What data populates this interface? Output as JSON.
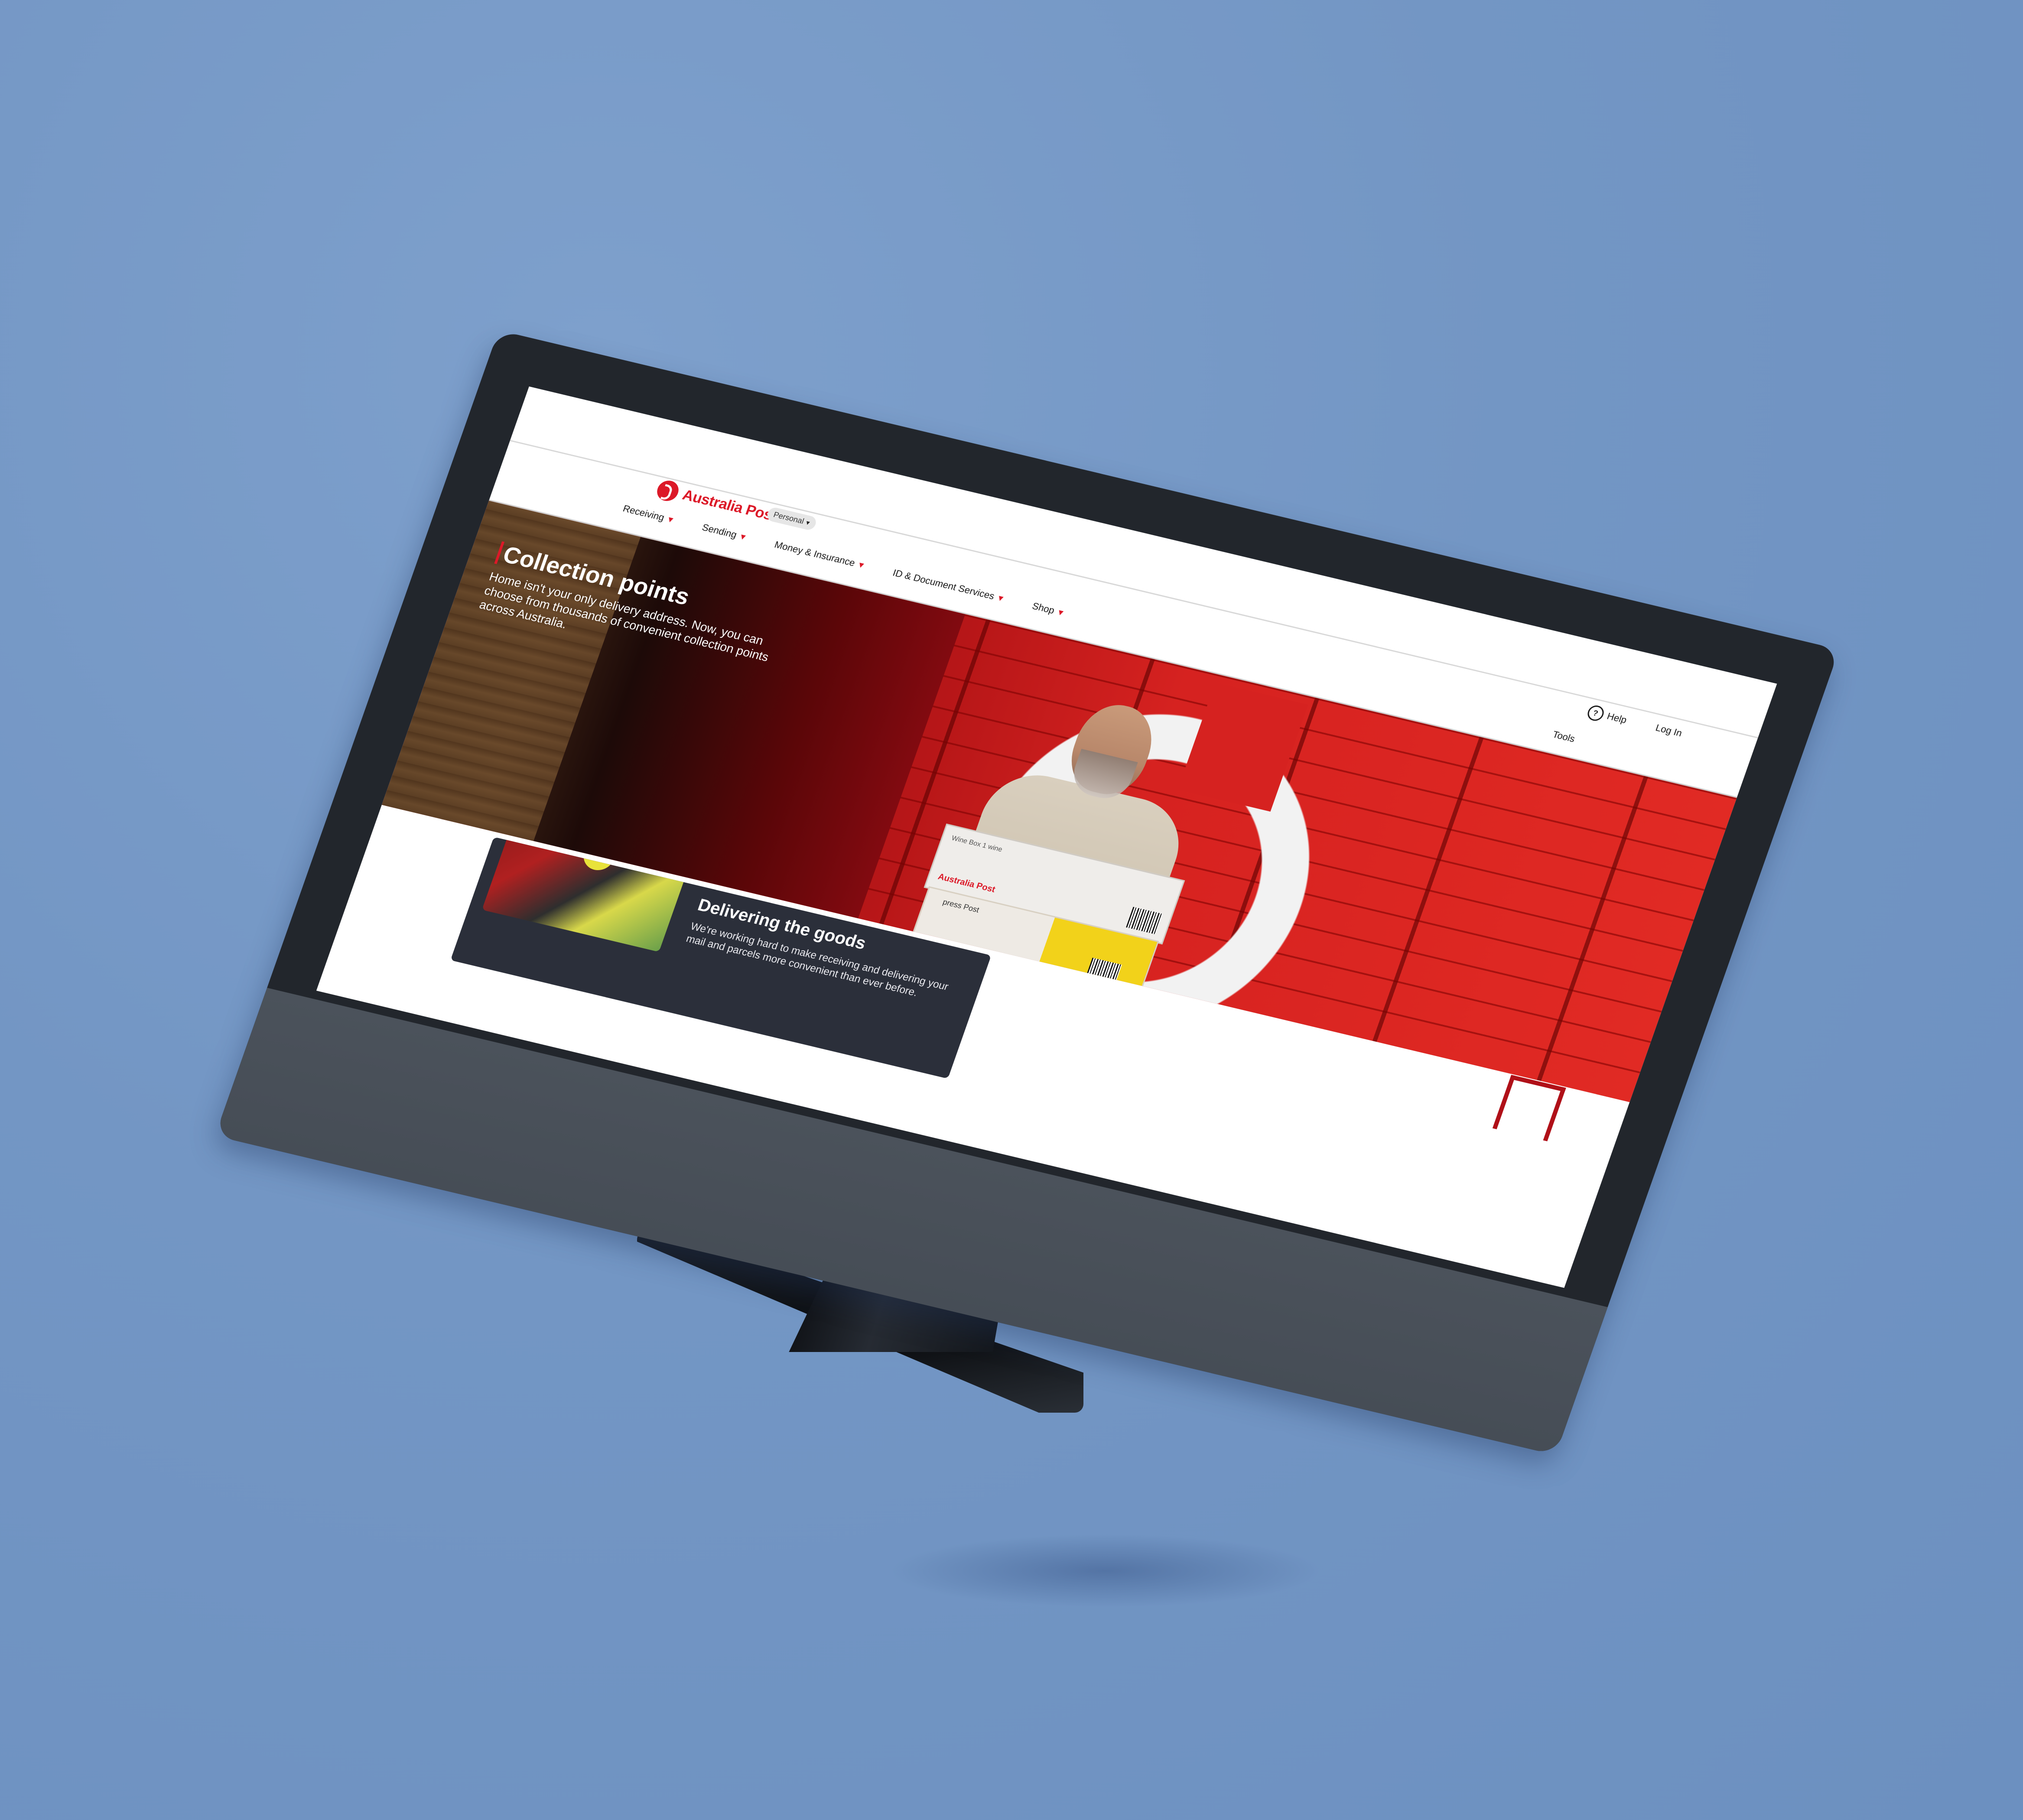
{
  "header": {
    "logo_text": "Australia Post",
    "audience_select": "Personal",
    "nav": [
      {
        "label": "Receiving"
      },
      {
        "label": "Sending"
      },
      {
        "label": "Money & Insurance"
      },
      {
        "label": "ID & Document Services"
      },
      {
        "label": "Shop"
      }
    ],
    "help_label": "Help",
    "login_label": "Log In",
    "tools_label": "Tools"
  },
  "hero": {
    "title": "Collection points",
    "subtitle": "Home isn't your only delivery address. Now, you can choose from thousands of convenient collection points across Australia.",
    "box_brand": "Australia Post",
    "box_label": "Wine Box 1 wine",
    "box2_label": "press Post"
  },
  "card": {
    "title": "Delivering the goods",
    "text": "We're working hard to make receiving and delivering your mail and parcels more convenient than ever before."
  },
  "colors": {
    "brand_red": "#dc1928",
    "background": "#7396c4",
    "bezel": "#22262c",
    "card": "#2b2f3a"
  },
  "icons": [
    "help-circle-icon",
    "chevron-down-icon",
    "australia-post-logo-icon"
  ]
}
